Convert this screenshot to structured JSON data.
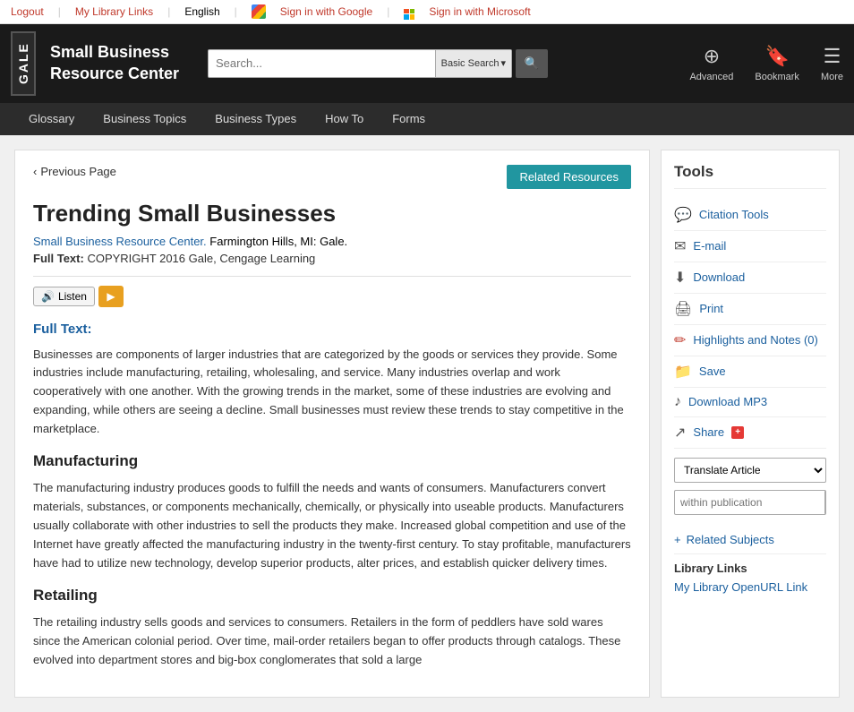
{
  "topbar": {
    "logout": "Logout",
    "my_library_links": "My Library Links",
    "language": "English",
    "sign_in_google": "Sign in with Google",
    "sign_in_microsoft": "Sign in with Microsoft"
  },
  "header": {
    "gale_label": "GALE",
    "site_title_line1": "Small Business",
    "site_title_line2": "Resource Center",
    "search_placeholder": "Search...",
    "search_type": "Basic Search",
    "advanced_label": "Advanced",
    "bookmark_label": "Bookmark",
    "more_label": "More"
  },
  "nav": {
    "items": [
      "Glossary",
      "Business Topics",
      "Business Types",
      "How To",
      "Forms"
    ]
  },
  "article": {
    "prev_page": "Previous Page",
    "related_resources_btn": "Related Resources",
    "title": "Trending Small Businesses",
    "source_link": "Small Business Resource Center.",
    "source_rest": " Farmington Hills, MI: Gale.",
    "full_text_label": "Full Text:",
    "copyright": "COPYRIGHT 2016 Gale, Cengage Learning",
    "listen_label": "Listen",
    "full_text_heading": "Full Text:",
    "body_para1": "Businesses are components of larger industries that are categorized by the goods or services they provide. Some industries include manufacturing, retailing, wholesaling, and service. Many industries overlap and work cooperatively with one another. With the growing trends in the market, some of these industries are evolving and expanding, while others are seeing a decline. Small businesses must review these trends to stay competitive in the marketplace.",
    "section1_heading": "Manufacturing",
    "section1_para": "The manufacturing industry produces goods to fulfill the needs and wants of consumers. Manufacturers convert materials, substances, or components mechanically, chemically, or physically into useable products. Manufacturers usually collaborate with other industries to sell the products they make. Increased global competition and use of the Internet have greatly affected the manufacturing industry in the twenty-first century. To stay profitable, manufacturers have had to utilize new technology, develop superior products, alter prices, and establish quicker delivery times.",
    "section2_heading": "Retailing",
    "section2_para": "The retailing industry sells goods and services to consumers. Retailers in the form of peddlers have sold wares since the American colonial period. Over time, mail-order retailers began to offer products through catalogs. These evolved into department stores and big-box conglomerates that sold a large"
  },
  "tools": {
    "title": "Tools",
    "citation_tools": "Citation Tools",
    "email": "E-mail",
    "download": "Download",
    "print": "Print",
    "highlights_notes": "Highlights and Notes (0)",
    "save": "Save",
    "download_mp3": "Download MP3",
    "share": "Share",
    "translate_label": "Translate Article",
    "within_pub_placeholder": "within publication",
    "related_subjects": "Related Subjects",
    "library_links_title": "Library Links",
    "library_link": "My Library OpenURL Link"
  }
}
